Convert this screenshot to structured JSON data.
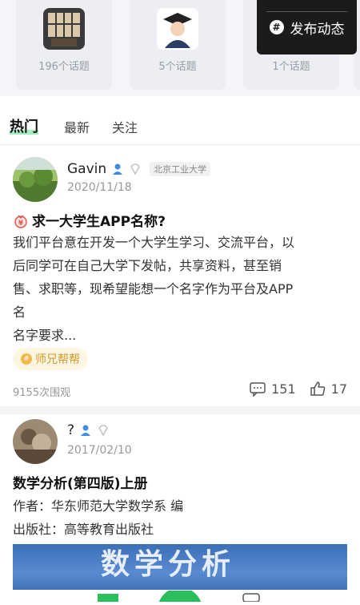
{
  "topics": [
    {
      "count": "196个话题"
    },
    {
      "count": "5个话题"
    },
    {
      "count": "1个话题"
    }
  ],
  "publish_label": "发布动态",
  "tabs": {
    "hot": "热门",
    "latest": "最新",
    "follow": "关注"
  },
  "posts": [
    {
      "user": "Gavin",
      "school": "北京工业大学",
      "date": "2020/11/18",
      "title": "求一大学生APP名称?",
      "body_lines": [
        "我们平台意在开发一个大学生学习、交流平台，以",
        "后同学可在自己大学下发帖，共享资料，甚至销",
        "售、求职等，现希望能想一个名字作为平台及APP",
        "名",
        "名字要求..."
      ],
      "tag": "师兄帮帮",
      "views": "9155次围观",
      "comments": "151",
      "likes": "17"
    },
    {
      "user": "?",
      "date": "2017/02/10",
      "title": "数学分析(第四版)上册",
      "body_lines": [
        "作者：华东师范大学数学系 编",
        "出版社：高等教育出版社"
      ],
      "cover_text": "数学分析"
    }
  ],
  "colors": {
    "accent": "#7fe7a8",
    "tag_bg": "#fdf6e3",
    "tag_text": "#d29a2d",
    "publish_bg": "#1b1b1b"
  }
}
